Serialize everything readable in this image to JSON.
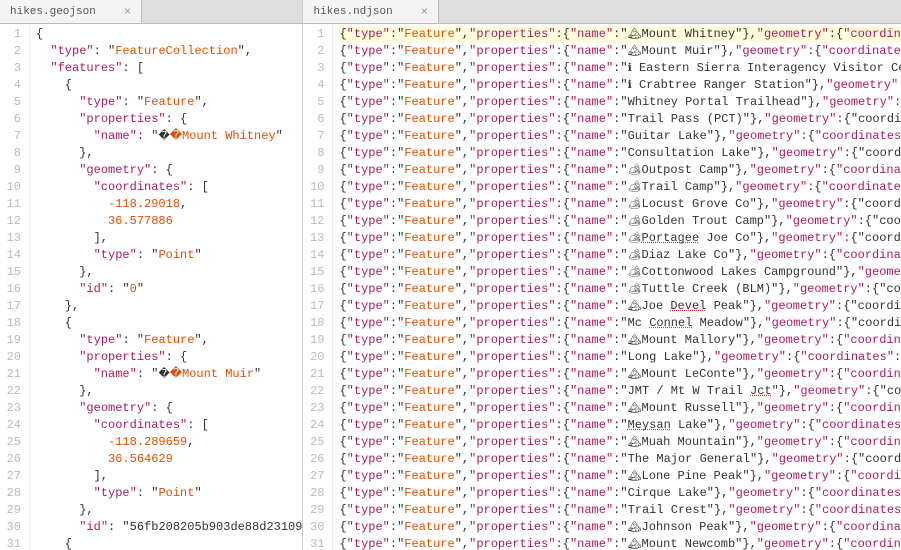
{
  "left": {
    "tab": {
      "title": "hikes.geojson",
      "close": "×"
    },
    "lines": [
      "{",
      "  \"type\": \"FeatureCollection\",",
      "  \"features\": [",
      "    {",
      "      \"type\": \"Feature\",",
      "      \"properties\": {",
      "        \"name\": \"🏔Mount Whitney\"",
      "      },",
      "      \"geometry\": {",
      "        \"coordinates\": [",
      "          -118.29018,",
      "          36.577886",
      "        ],",
      "        \"type\": \"Point\"",
      "      },",
      "      \"id\": \"0\"",
      "    },",
      "    {",
      "      \"type\": \"Feature\",",
      "      \"properties\": {",
      "        \"name\": \"🏔Mount Muir\"",
      "      },",
      "      \"geometry\": {",
      "        \"coordinates\": [",
      "          -118.289659,",
      "          36.564629",
      "        ],",
      "        \"type\": \"Point\"",
      "      },",
      "      \"id\": \"56fb208205b903de88d23109",
      "    {"
    ]
  },
  "right": {
    "tab": {
      "title": "hikes.ndjson",
      "close": "×"
    },
    "highlight_line": 1,
    "lines": [
      {
        "icon": "🏔",
        "name": "Mount Whitney",
        "tail": "},\"geometry\":{\"coordinates\":"
      },
      {
        "icon": "🏔",
        "name": "Mount Muir",
        "tail": "},\"geometry\":{\"coordinates\":[-1"
      },
      {
        "icon": "ℹ",
        "name": " Eastern Sierra Interagency Visitor Center",
        "tail": ""
      },
      {
        "icon": "ℹ",
        "name": " Crabtree Ranger Station",
        "tail": "},\"geometry\":{\"coo"
      },
      {
        "icon": "",
        "name": "Whitney Portal Trailhead",
        "tail": "},\"geometry\":{\"coo"
      },
      {
        "icon": "",
        "name": "Trail Pass (PCT)",
        "tail": "},\"geometry\":{\"coordinates"
      },
      {
        "icon": "",
        "name": "Guitar Lake",
        "tail": "},\"geometry\":{\"coordinates\":[-11"
      },
      {
        "icon": "",
        "name": "Consultation Lake",
        "tail": "},\"geometry\":{\"coordinate"
      },
      {
        "icon": "🏕",
        "name": "Outpost Camp",
        "tail": "},\"geometry\":{\"coordinates\":["
      },
      {
        "icon": "🏕",
        "name": "Trail Camp",
        "tail": "},\"geometry\":{\"coordinates\":[-1"
      },
      {
        "icon": "🏕",
        "name": "Locust Grove Co",
        "tail": "},\"geometry\":{\"coordinates"
      },
      {
        "icon": "🏕",
        "name": "Golden Trout Camp",
        "tail": "},\"geometry\":{\"coordinat"
      },
      {
        "icon": "🏕",
        "name": "Portagee Joe Co",
        "partial": "Portagee",
        "tail": "},\"geometry\":{\"coordinates"
      },
      {
        "icon": "🏕",
        "name": "Diaz Lake Co",
        "tail": "},\"geometry\":{\"coordinates\":["
      },
      {
        "icon": "🏕",
        "name": "Cottonwood Lakes Campground",
        "tail": "},\"geometry\":{"
      },
      {
        "icon": "🏕",
        "name": "Tuttle Creek (BLM)",
        "tail": "},\"geometry\":{\"coordina"
      },
      {
        "icon": "🏔",
        "name": "Joe Devel Peak",
        "partial": "Devel",
        "tail": "},\"geometry\":{\"coordinates"
      },
      {
        "icon": "",
        "name": "Mc Connel Meadow",
        "partial": "Connel",
        "tail": "},\"geometry\":{\"coordinate"
      },
      {
        "icon": "🏔",
        "name": "Mount Mallory",
        "tail": "},\"geometry\":{\"coordinates\":"
      },
      {
        "icon": "",
        "name": "Long Lake",
        "tail": "},\"geometry\":{\"coordinates\":[-118."
      },
      {
        "icon": "🏔",
        "name": "Mount LeConte",
        "tail": "},\"geometry\":{\"coordinates\":"
      },
      {
        "icon": "",
        "name": "JMT / Mt W Trail Jct",
        "partial": "Jct",
        "tail": "},\"geometry\":{\"coordina"
      },
      {
        "icon": "🏔",
        "name": "Mount Russell",
        "tail": "},\"geometry\":{\"coordinates\":"
      },
      {
        "icon": "",
        "name": "Meysan Lake",
        "partial": "Meysan",
        "tail": "},\"geometry\":{\"coordinates\":[-11"
      },
      {
        "icon": "🏔",
        "name": "Muah Mountain",
        "tail": "},\"geometry\":{\"coordinates\":"
      },
      {
        "icon": "",
        "name": "The Major General",
        "tail": "},\"geometry\":{\"coordinate"
      },
      {
        "icon": "🏔",
        "name": "Lone Pine Peak",
        "tail": "},\"geometry\":{\"coordinates\""
      },
      {
        "icon": "",
        "name": "Cirque Lake",
        "tail": "},\"geometry\":{\"coordinates\":[-11"
      },
      {
        "icon": "",
        "name": "Trail Crest",
        "tail": "},\"geometry\":{\"coordinates\":[-11"
      },
      {
        "icon": "🏔",
        "name": "Johnson Peak",
        "tail": "},\"geometry\":{\"coordinates\":["
      },
      {
        "icon": "🏔",
        "name": "Mount Newcomb",
        "tail": "},\"geometry\":{\"coordinates\":"
      }
    ]
  }
}
